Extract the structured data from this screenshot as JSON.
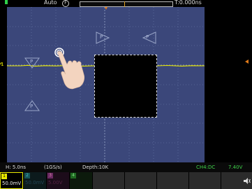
{
  "top": {
    "mode": "Auto",
    "f_button": "F",
    "time_delay": "T:0.000ns"
  },
  "markers": {
    "trigger_level": "T",
    "channel_1": "1"
  },
  "touch_zones": {
    "label": "P"
  },
  "status": {
    "timebase": "H: 5.0ns",
    "sample_rate": "(1GS/s)",
    "depth": "Depth:10K",
    "trigger": "CH4:DC",
    "trigger_level": "7.40V"
  },
  "channels": [
    {
      "num": "1",
      "value": "50.0mV",
      "color": "#e8e800"
    },
    {
      "num": "2",
      "value": "50.0mV",
      "color": "#3ad6e8"
    },
    {
      "num": "3",
      "value": "5.00V",
      "color": "#e066d8"
    },
    {
      "num": "4",
      "value": "",
      "color": "#3fd24a"
    }
  ],
  "colors": {
    "ch1": "#e8e800",
    "screen_bg": "#3b477a",
    "grid": "#7788aa",
    "trigger_orange": "#e07a1a"
  }
}
